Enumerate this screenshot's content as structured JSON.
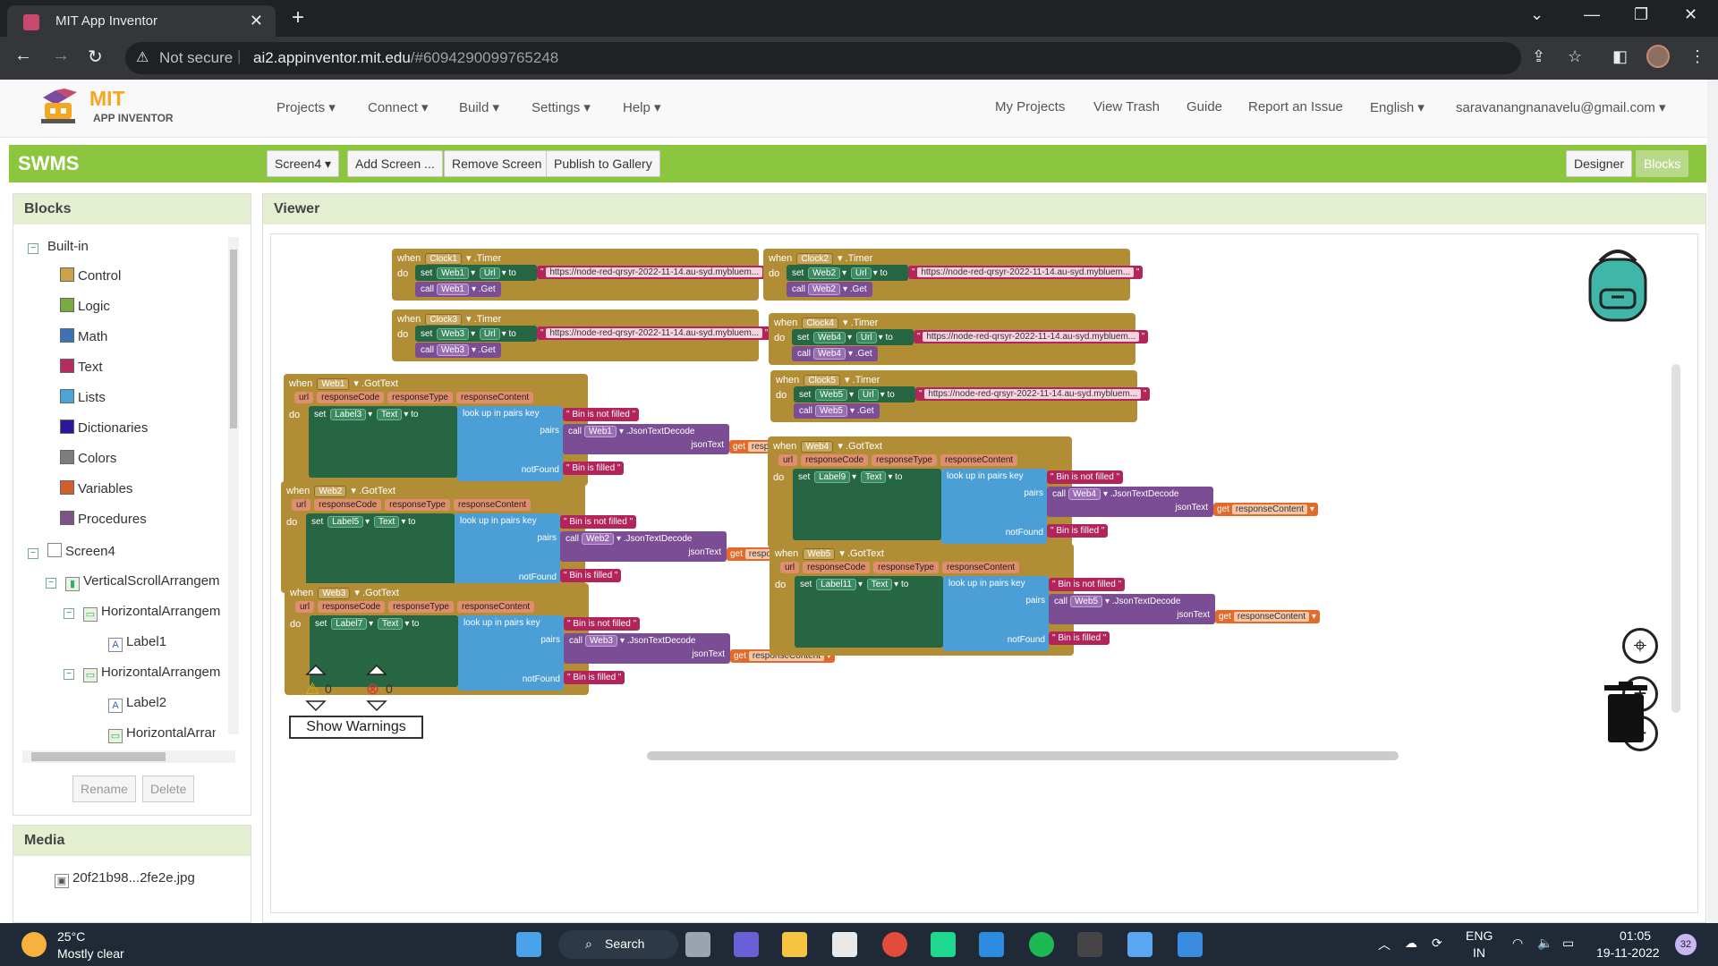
{
  "browser": {
    "tab_title": "MIT App Inventor",
    "tab_close": "✕",
    "new_tab": "+",
    "security_label": "Not secure",
    "url_host": "ai2.appinventor.mit.edu",
    "url_path": "/#6094290099765248"
  },
  "app": {
    "logo_mit": "MIT",
    "logo_sub": "APP INVENTOR",
    "menu": {
      "projects": "Projects ▾",
      "connect": "Connect ▾",
      "build": "Build ▾",
      "settings": "Settings ▾",
      "help": "Help ▾",
      "my_projects": "My Projects",
      "view_trash": "View Trash",
      "guide": "Guide",
      "report": "Report an Issue",
      "language": "English ▾",
      "account": "saravanangnanavelu@gmail.com ▾"
    },
    "project_name": "SWMS",
    "screen_select": "Screen4 ▾",
    "add_screen": "Add Screen ...",
    "remove_screen": "Remove Screen",
    "publish": "Publish to Gallery",
    "designer": "Designer",
    "blocks": "Blocks"
  },
  "blocks_panel": {
    "title": "Blocks",
    "built_in": "Built-in",
    "categories": [
      {
        "label": "Control",
        "color": "#c9a24a"
      },
      {
        "label": "Logic",
        "color": "#77ab41"
      },
      {
        "label": "Math",
        "color": "#3f71b5"
      },
      {
        "label": "Text",
        "color": "#b32d5e"
      },
      {
        "label": "Lists",
        "color": "#49a6d4"
      },
      {
        "label": "Dictionaries",
        "color": "#2d1799"
      },
      {
        "label": "Colors",
        "color": "#7d7d7d"
      },
      {
        "label": "Variables",
        "color": "#d05f2d"
      },
      {
        "label": "Procedures",
        "color": "#7c5385"
      }
    ],
    "screen": "Screen4",
    "components": [
      "VerticalScrollArrangem",
      "HorizontalArrangem",
      "Label1",
      "HorizontalArrangem",
      "Label2",
      "HorizontalArrang"
    ],
    "rename": "Rename",
    "delete": "Delete"
  },
  "media": {
    "title": "Media",
    "file1": "20f21b98...2fe2e.jpg"
  },
  "viewer": {
    "title": "Viewer",
    "warn_count": "0",
    "error_count": "0",
    "show_warnings": "Show Warnings",
    "url_text": "https://node-red-qrsyr-2022-11-14.au-syd.mybluem...",
    "timers": [
      {
        "clock": "Clock1",
        "web": "Web1"
      },
      {
        "clock": "Clock2",
        "web": "Web2"
      },
      {
        "clock": "Clock3",
        "web": "Web3"
      },
      {
        "clock": "Clock4",
        "web": "Web4"
      },
      {
        "clock": "Clock5",
        "web": "Web5"
      }
    ],
    "gottext": [
      {
        "web": "Web1",
        "label": "Label3"
      },
      {
        "web": "Web2",
        "label": "Label5"
      },
      {
        "web": "Web3",
        "label": "Label7"
      },
      {
        "web": "Web4",
        "label": "Label9"
      },
      {
        "web": "Web5",
        "label": "Label11"
      }
    ],
    "kw": {
      "when": "when",
      "do": "do",
      "set": "set",
      "call": "call",
      "to": "to",
      "get": "get",
      "timer": ".Timer",
      "url": "Url",
      "get_method": ".Get",
      "gottext": ".GotText",
      "text_prop": "Text",
      "lookup": "look up in pairs  key",
      "pairs": "pairs",
      "notfound": "notFound",
      "jsontext": "jsonText",
      "jsondecode": ".JsonTextDecode",
      "p_url": "url",
      "p_code": "responseCode",
      "p_type": "responseType",
      "p_content": "responseContent",
      "bin_not": "Bin is not filled",
      "bin_filled": "Bin is filled"
    }
  },
  "taskbar": {
    "temp": "25°C",
    "weather": "Mostly clear",
    "search": "Search",
    "lang1": "ENG",
    "lang2": "IN",
    "time": "01:05",
    "date": "19-11-2022",
    "badge": "32"
  }
}
